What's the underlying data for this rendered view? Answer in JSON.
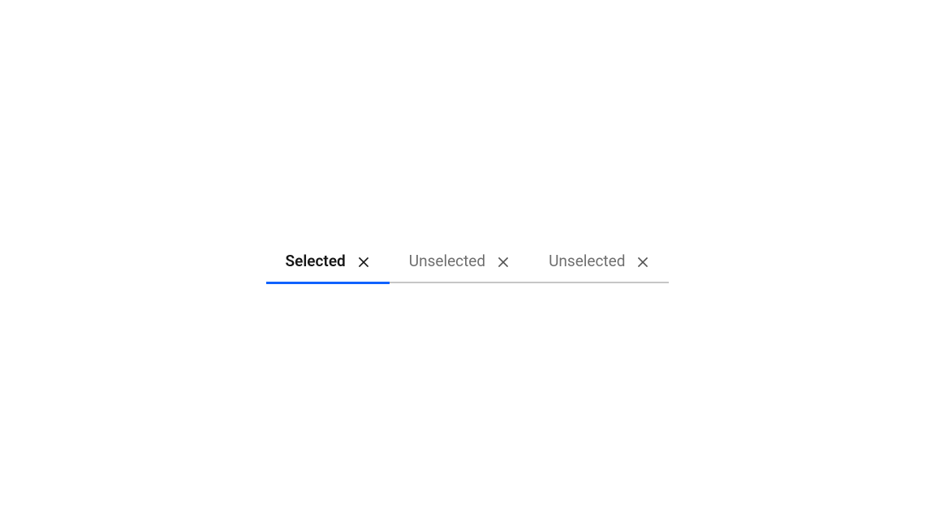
{
  "tabs": [
    {
      "label": "Selected",
      "selected": true
    },
    {
      "label": "Unselected",
      "selected": false
    },
    {
      "label": "Unselected",
      "selected": false
    }
  ]
}
